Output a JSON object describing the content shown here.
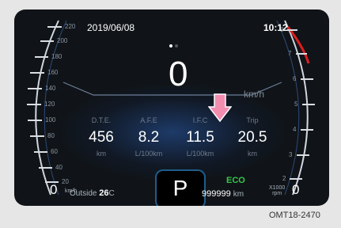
{
  "header": {
    "date": "2019/06/08",
    "time": "10:12"
  },
  "speed": {
    "value": "0",
    "unit": "km/h"
  },
  "speedometer": {
    "scale_labels": [
      "220",
      "200",
      "180",
      "160",
      "140",
      "120",
      "100",
      "80",
      "60",
      "40",
      "20"
    ],
    "zero": "0",
    "unit": "km/h"
  },
  "tachometer": {
    "scale_labels": [
      "8",
      "7",
      "6",
      "5",
      "4",
      "3",
      "2",
      "1"
    ],
    "zero": "0",
    "unit_top": "X1000",
    "unit_bottom": "rpm"
  },
  "trip_info": [
    {
      "label": "D.T.E.",
      "value": "456",
      "unit": "km"
    },
    {
      "label": "A.F.E",
      "value": "8.2",
      "unit": "L/100km"
    },
    {
      "label": "I.F.C",
      "value": "11.5",
      "unit": "L/100km"
    },
    {
      "label": "Trip",
      "value": "20.5",
      "unit": "km"
    }
  ],
  "outside": {
    "label": "Outside",
    "temp": "26",
    "unit": "C"
  },
  "gear": "P",
  "odometer": {
    "value": "999999",
    "unit": "km"
  },
  "eco": "ECO",
  "caption": "OMT18-2470",
  "colors": {
    "eco": "#35c84b",
    "arrow": "#f28db0",
    "redline": "#e01e1e",
    "gear_border": "#1f5c8c"
  }
}
